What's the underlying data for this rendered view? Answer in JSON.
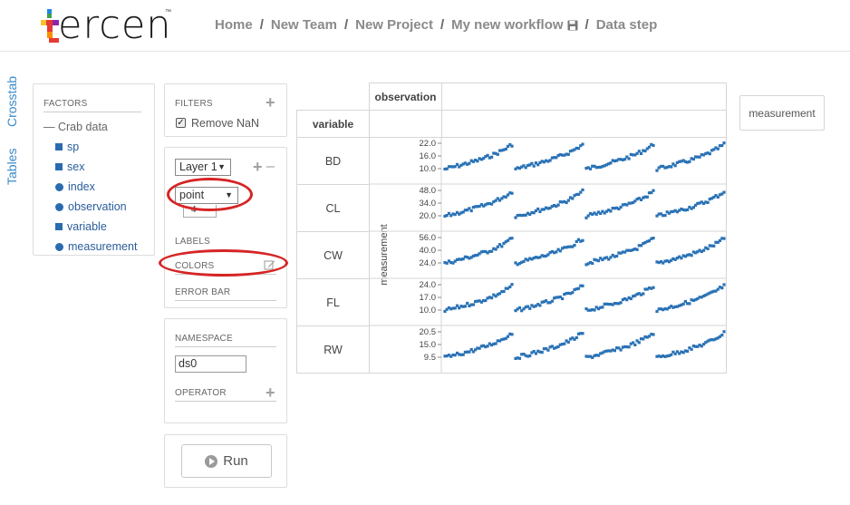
{
  "app": {
    "logo_text": "ercen",
    "logo_tm": "™",
    "brand_colors": [
      "#e53935",
      "#43a047",
      "#1e88e5",
      "#fbc02d"
    ]
  },
  "breadcrumb": {
    "items": [
      "Home",
      "New Team",
      "New Project",
      "My new workflow",
      "Data step"
    ],
    "separator": "/"
  },
  "side_tabs": {
    "crosstab": "Crosstab",
    "tables": "Tables"
  },
  "factors": {
    "title": "FACTORS",
    "root": "Crab data",
    "items": [
      {
        "label": "sp",
        "kind": "square"
      },
      {
        "label": "sex",
        "kind": "square"
      },
      {
        "label": "index",
        "kind": "dot"
      },
      {
        "label": "observation",
        "kind": "dot"
      },
      {
        "label": "variable",
        "kind": "square"
      },
      {
        "label": "measurement",
        "kind": "dot"
      }
    ]
  },
  "filters": {
    "title": "FILTERS",
    "remove_nan_label": "Remove NaN",
    "remove_nan_checked": true
  },
  "layer": {
    "layer_select": "Layer 1",
    "geom_select": "point",
    "size_value": "4",
    "labels_title": "LABELS",
    "colors_title": "COLORS",
    "error_bar_title": "ERROR BAR"
  },
  "namespace": {
    "title": "NAMESPACE",
    "value": "ds0",
    "operator_title": "OPERATOR"
  },
  "run": {
    "label": "Run"
  },
  "crosstab": {
    "column_header": "observation",
    "row_header": "variable",
    "y_axis_label": "measurement",
    "y_drop_label": "measurement",
    "rows": [
      {
        "label": "BD",
        "ticks": [
          "22.0",
          "16.0",
          "10.0"
        ]
      },
      {
        "label": "CL",
        "ticks": [
          "48.0",
          "34.0",
          "20.0"
        ]
      },
      {
        "label": "CW",
        "ticks": [
          "56.0",
          "40.0",
          "24.0"
        ]
      },
      {
        "label": "FL",
        "ticks": [
          "24.0",
          "17.0",
          "10.0"
        ]
      },
      {
        "label": "RW",
        "ticks": [
          "20.5",
          "15.0",
          "9.5"
        ]
      }
    ],
    "point_color": "#2a72b5"
  },
  "annotation_color": "#d62424"
}
